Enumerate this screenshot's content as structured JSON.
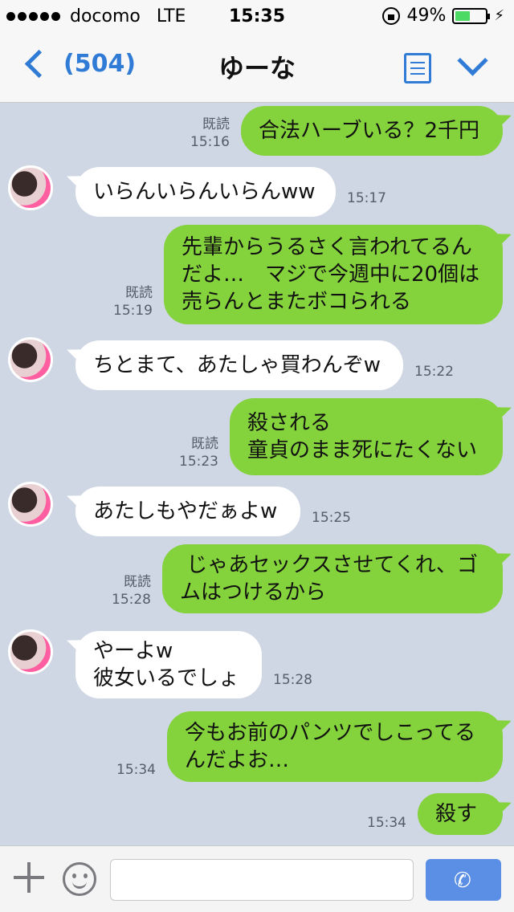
{
  "status": {
    "carrier": "docomo",
    "network": "LTE",
    "time": "15:35",
    "battery": "49%",
    "battery_level": 0.49
  },
  "nav": {
    "back_count": "(504)",
    "title": "ゆーな"
  },
  "messages": [
    {
      "dir": "out",
      "lines": [
        "合法ハーブいる？2千円"
      ],
      "read": "既読",
      "time": "15:16"
    },
    {
      "dir": "in",
      "lines": [
        "いらんいらんいらんww"
      ],
      "time": "15:17"
    },
    {
      "dir": "out",
      "lines": [
        "先輩からうるさく言われてるん",
        "だよ…　マジで今週中に20個は",
        "売らんとまたボコられる"
      ],
      "read": "既読",
      "time": "15:19"
    },
    {
      "dir": "in",
      "lines": [
        "ちとまて、あたしゃ買わんぞw"
      ],
      "time": "15:22"
    },
    {
      "dir": "out",
      "lines": [
        "殺される",
        "童貞のまま死にたくない"
      ],
      "read": "既読",
      "time": "15:23"
    },
    {
      "dir": "in",
      "lines": [
        "あたしもやだぁよw"
      ],
      "time": "15:25"
    },
    {
      "dir": "out",
      "lines": [
        " じゃあセックスさせてくれ、ゴ",
        "ムはつけるから"
      ],
      "read": "既読",
      "time": "15:28"
    },
    {
      "dir": "in",
      "lines": [
        "やーよw",
        "彼女いるでしょ"
      ],
      "time": "15:28"
    },
    {
      "dir": "out",
      "lines": [
        "今もお前のパンツでしこってる",
        "んだよお…"
      ],
      "time": "15:34"
    },
    {
      "dir": "out",
      "lines": [
        "殺す"
      ],
      "time": "15:34"
    }
  ],
  "input": {
    "placeholder": ""
  },
  "colors": {
    "accent": "#2f7bd6",
    "outgoing_bubble": "#84d23c",
    "incoming_bubble": "#ffffff",
    "chat_background": "#cfd6e4",
    "call_button": "#5b8fe6"
  },
  "icons": {
    "back": "chevron-left-icon",
    "menu": "note-icon",
    "more": "chevron-down-icon",
    "add": "plus-icon",
    "emoji": "smile-icon",
    "call": "phone-icon"
  }
}
